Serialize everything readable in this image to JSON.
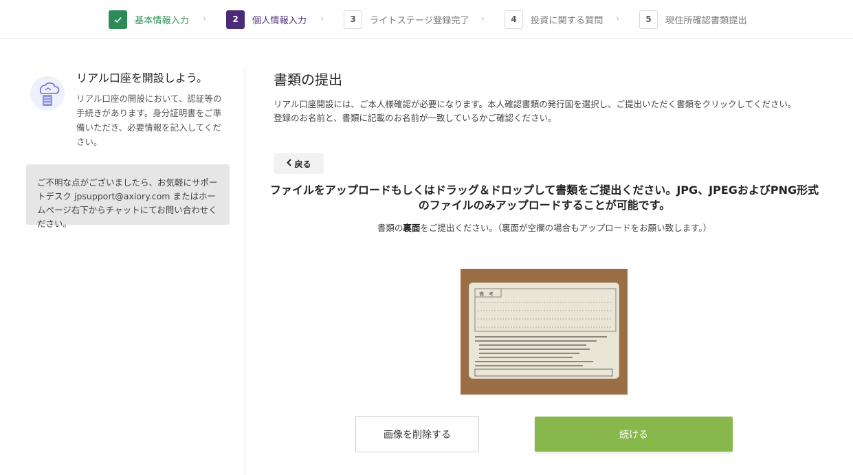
{
  "stepper": {
    "steps": [
      {
        "number": "",
        "label": "基本情報入力",
        "status": "done"
      },
      {
        "number": "2",
        "label": "個人情報入力",
        "status": "active"
      },
      {
        "number": "3",
        "label": "ライトステージ登録完了",
        "status": "todo"
      },
      {
        "number": "4",
        "label": "投資に関する質問",
        "status": "todo"
      },
      {
        "number": "5",
        "label": "現住所確認書類提出",
        "status": "todo"
      }
    ]
  },
  "sidebar": {
    "intro_title": "リアル口座を開設しよう。",
    "intro_text": "リアル口座の開設において、認証等の手続きがあります。身分証明書をご準備いただき、必要情報を記入してください。",
    "help_text": "ご不明な点がございましたら、お気軽にサポートデスク jpsupport@axiory.com またはホームページ右下からチャットにてお問い合わせください。"
  },
  "main": {
    "title": "書類の提出",
    "description_line1": "リアル口座開設には、ご本人様確認が必要になります。本人確認書類の発行国を選択し、ご提出いただく書類をクリックしてください。",
    "description_line2": "登録のお名前と、書類に記載のお名前が一致しているかご確認ください。",
    "back_label": "戻る",
    "upload_heading": "ファイルをアップロードもしくはドラッグ＆ドロップして書類をご提出ください。JPG、JPEGおよびPNG形式のファイルのみアップロードすることが可能です。",
    "side_note_prefix": "書類の",
    "side_note_bold": "裏面",
    "side_note_suffix": "をご提出ください。（裏面が空欄の場合もアップロードをお願い致します。）",
    "card_heading": "備　考",
    "delete_label": "画像を削除する",
    "continue_label": "続ける"
  },
  "colors": {
    "done": "#2e8b57",
    "active": "#4b2a78",
    "continue_button": "#88b84c"
  }
}
